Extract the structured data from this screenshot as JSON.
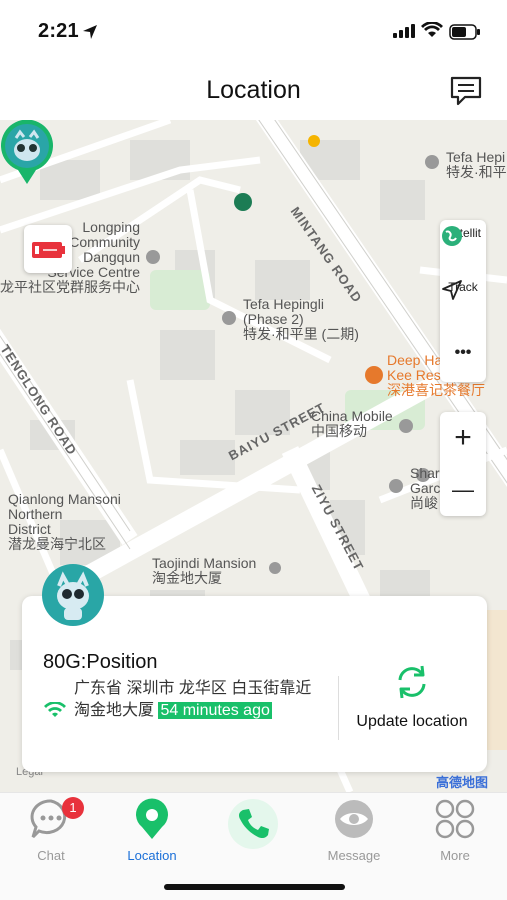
{
  "status_bar": {
    "time": "2:21"
  },
  "header": {
    "title": "Location"
  },
  "map": {
    "labels": {
      "longping": "Longping\nCommunity\nDangqun\nService Centre\n龙平社区党群服务中心",
      "tefa_top": "Tefa Hepi\n特发·和平",
      "tefa_phase2": "Tefa Hepingli\n(Phase 2)\n特发·和平里 (二期)",
      "deep_ha": "Deep Ha   ey\nKee Res\n深港喜记茶餐厅",
      "china_mobile": "China Mobile\n中国移动",
      "qianlong": "Qianlong Mansoni\nNorthern\nDistrict\n潜龙曼海宁北区",
      "taojindi": "Taojindi Mansion\n淘金地大厦",
      "shar": "Shar\nGarc     se\n尚峻",
      "legal": "Legal",
      "gaode": "高德地图"
    },
    "roads": {
      "tenglong": "TENGLONG ROAD",
      "mintang": "MINTANG ROAD",
      "baiyu": "BAIYU STREET",
      "ziyu": "ZIYU STREET"
    },
    "tools": {
      "satellite": "Satellit",
      "track": "Track",
      "more": "•••"
    },
    "zoom": {
      "plus": "+",
      "minus": "—"
    }
  },
  "device_card": {
    "title": "80G:Position",
    "address": "广东省 深圳市 龙华区 白玉街靠近淘金地大厦",
    "time_ago": "54 minutes ago",
    "update_label": "Update location"
  },
  "tabs": [
    {
      "label": "Chat",
      "badge": "1",
      "icon": "chat-bubble-icon"
    },
    {
      "label": "Location",
      "icon": "location-pin-icon",
      "active": true
    },
    {
      "label": "",
      "icon": "phone-icon"
    },
    {
      "label": "Message",
      "icon": "eye-icon"
    },
    {
      "label": "More",
      "icon": "four-circles-icon"
    }
  ],
  "colors": {
    "accent_green": "#19c06a",
    "active_blue": "#1a6fd8",
    "badge_red": "#e8323c"
  }
}
